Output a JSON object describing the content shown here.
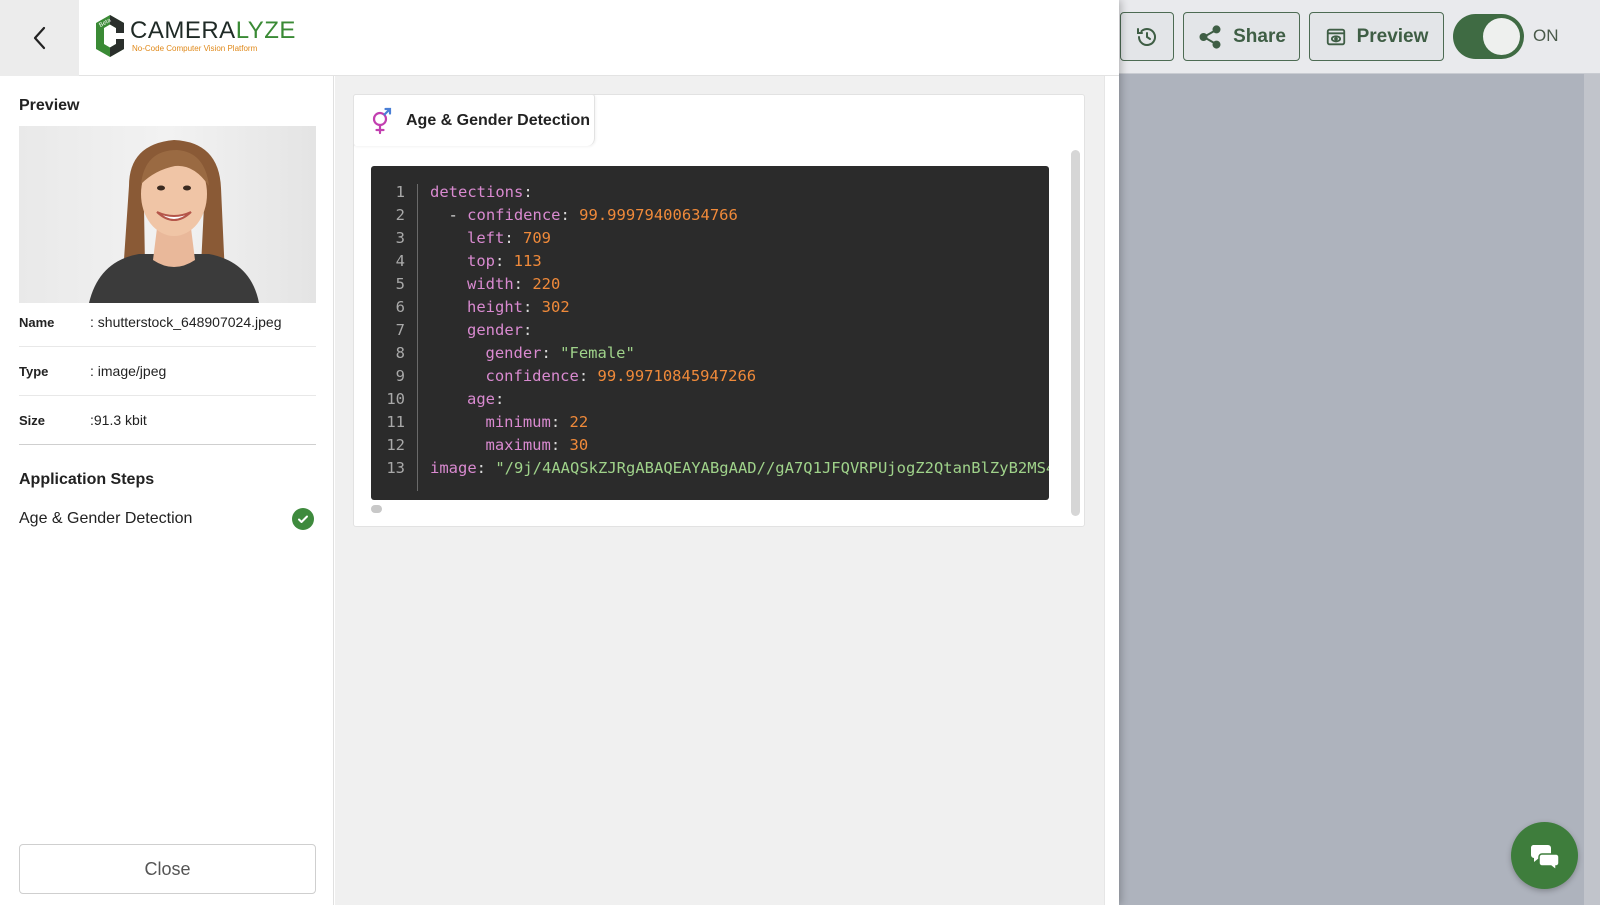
{
  "app": {
    "logo_text_part1": "CAMERA",
    "logo_text_part2": "LYZE",
    "logo_subtitle": "No-Code Computer Vision Platform",
    "logo_badge": "Beta"
  },
  "toolbar": {
    "share_label": "Share",
    "preview_label": "Preview",
    "toggle_label": "ON"
  },
  "sidebar": {
    "preview_title": "Preview",
    "info": [
      {
        "key": "Name",
        "value": ": shutterstock_648907024.jpeg"
      },
      {
        "key": "Type",
        "value": ": image/jpeg"
      },
      {
        "key": "Size",
        "value": ":91.3 kbit"
      }
    ],
    "steps_title": "Application Steps",
    "steps": [
      {
        "label": "Age & Gender Detection",
        "status": "done"
      }
    ],
    "close_label": "Close"
  },
  "result": {
    "tab_label": "Age & Gender Detection",
    "lines": [
      {
        "no": "1",
        "key": "detections",
        "indent": 0,
        "dash": false,
        "value": "",
        "vtype": ""
      },
      {
        "no": "2",
        "key": "confidence",
        "indent": 1,
        "dash": true,
        "value": "99.99979400634766",
        "vtype": "n"
      },
      {
        "no": "3",
        "key": "left",
        "indent": 2,
        "dash": false,
        "value": "709",
        "vtype": "n"
      },
      {
        "no": "4",
        "key": "top",
        "indent": 2,
        "dash": false,
        "value": "113",
        "vtype": "n"
      },
      {
        "no": "5",
        "key": "width",
        "indent": 2,
        "dash": false,
        "value": "220",
        "vtype": "n"
      },
      {
        "no": "6",
        "key": "height",
        "indent": 2,
        "dash": false,
        "value": "302",
        "vtype": "n"
      },
      {
        "no": "7",
        "key": "gender",
        "indent": 2,
        "dash": false,
        "value": "",
        "vtype": ""
      },
      {
        "no": "8",
        "key": "gender",
        "indent": 3,
        "dash": false,
        "value": "\"Female\"",
        "vtype": "s"
      },
      {
        "no": "9",
        "key": "confidence",
        "indent": 3,
        "dash": false,
        "value": "99.99710845947266",
        "vtype": "n"
      },
      {
        "no": "10",
        "key": "age",
        "indent": 2,
        "dash": false,
        "value": "",
        "vtype": ""
      },
      {
        "no": "11",
        "key": "minimum",
        "indent": 3,
        "dash": false,
        "value": "22",
        "vtype": "n"
      },
      {
        "no": "12",
        "key": "maximum",
        "indent": 3,
        "dash": false,
        "value": "30",
        "vtype": "n"
      },
      {
        "no": "13",
        "key": "image",
        "indent": 0,
        "dash": false,
        "value": "\"/9j/4AAQSkZJRgABAQEAYABgAAD//gA7Q1JFQVRPUjogZ2QtanBlZyB2MS4",
        "vtype": "s"
      }
    ]
  },
  "colors": {
    "brand_green": "#3a8a35",
    "brand_orange": "#e0891a",
    "code_bg": "#2b2b2b",
    "code_key": "#d98ad0",
    "code_number": "#f08a3a",
    "code_string": "#9fd28a"
  },
  "icons": {
    "back": "chevron-left-icon",
    "history": "history-icon",
    "share": "share-icon",
    "preview": "eye-icon",
    "chat": "chat-icon",
    "gender": "gender-symbol-icon",
    "check": "check-circle-icon"
  }
}
